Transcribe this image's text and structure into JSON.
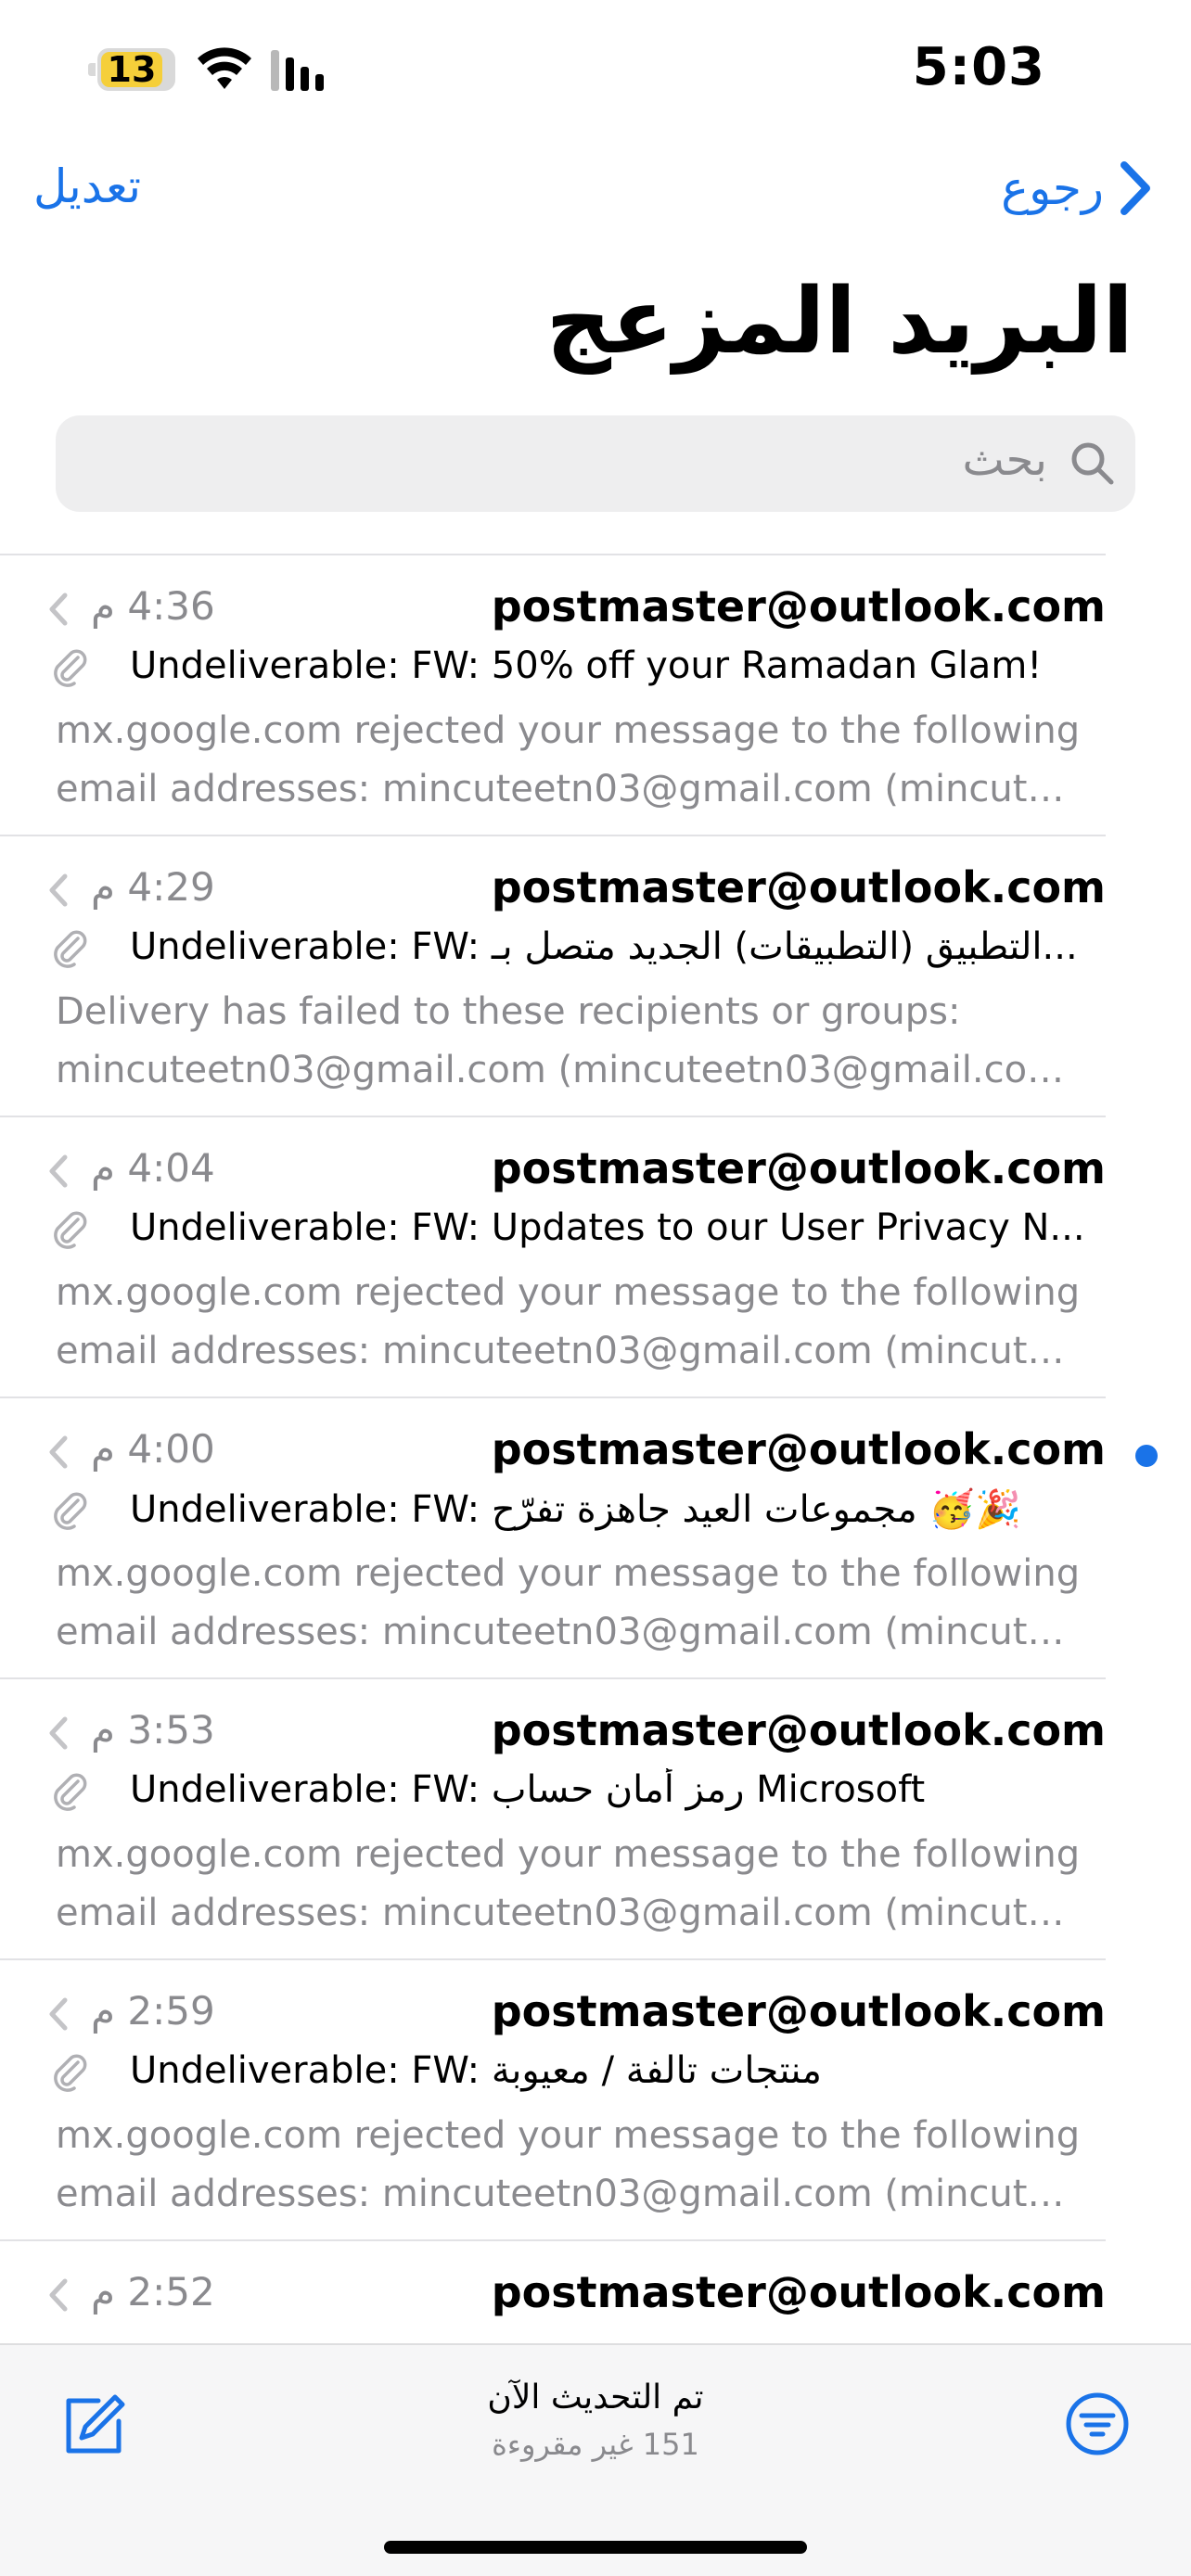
{
  "status_bar": {
    "time": "5:03",
    "battery_level": "13",
    "battery_color": "#f5cf3a"
  },
  "nav": {
    "edit_label": "تعديل",
    "back_label": "رجوع"
  },
  "title": "البريد المزعج",
  "search": {
    "placeholder": "بحث"
  },
  "accent_color": "#1a73e8",
  "messages": [
    {
      "sender": "postmaster@outlook.com",
      "time": "4:36 م",
      "subject": "Undeliverable: FW: 50% off your Ramadan Glam!",
      "preview_line1": "mx.google.com rejected your message to the following",
      "preview_line2": "email addresses: mincuteetn03@gmail.com (mincute...",
      "unread": false
    },
    {
      "sender": "postmaster@outlook.com",
      "time": "4:29 م",
      "subject": "Undeliverable: FW: التطبيق (التطبيقات) الجديد متصل بـ...",
      "preview_line1": "Delivery has failed to these recipients or groups:",
      "preview_line2": "mincuteetn03@gmail.com (mincuteetn03@gmail.com...",
      "unread": false
    },
    {
      "sender": "postmaster@outlook.com",
      "time": "4:04 م",
      "subject": "Undeliverable: FW: Updates to our User Privacy N...",
      "preview_line1": "mx.google.com rejected your message to the following",
      "preview_line2": "email addresses: mincuteetn03@gmail.com (mincute...",
      "unread": false
    },
    {
      "sender": "postmaster@outlook.com",
      "time": "4:00 م",
      "subject": "Undeliverable: FW: مجموعات العيد جاهزة تفرّح 🥳🎉",
      "preview_line1": "mx.google.com rejected your message to the following",
      "preview_line2": "email addresses: mincuteetn03@gmail.com (mincute...",
      "unread": true
    },
    {
      "sender": "postmaster@outlook.com",
      "time": "3:53 م",
      "subject": "Undeliverable: FW: رمز أمان حساب Microsoft",
      "preview_line1": "mx.google.com rejected your message to the following",
      "preview_line2": "email addresses: mincuteetn03@gmail.com (mincute...",
      "unread": false
    },
    {
      "sender": "postmaster@outlook.com",
      "time": "2:59 م",
      "subject": "Undeliverable: FW: منتجات تالفة / معيوبة",
      "preview_line1": "mx.google.com rejected your message to the following",
      "preview_line2": "email addresses: mincuteetn03@gmail.com (mincute...",
      "unread": false
    },
    {
      "sender": "postmaster@outlook.com",
      "time": "2:52 م",
      "subject": "",
      "preview_line1": "",
      "preview_line2": "",
      "unread": false
    }
  ],
  "toolbar": {
    "status": "تم التحديث الآن",
    "unread_count": "151 غير مقروءة"
  }
}
